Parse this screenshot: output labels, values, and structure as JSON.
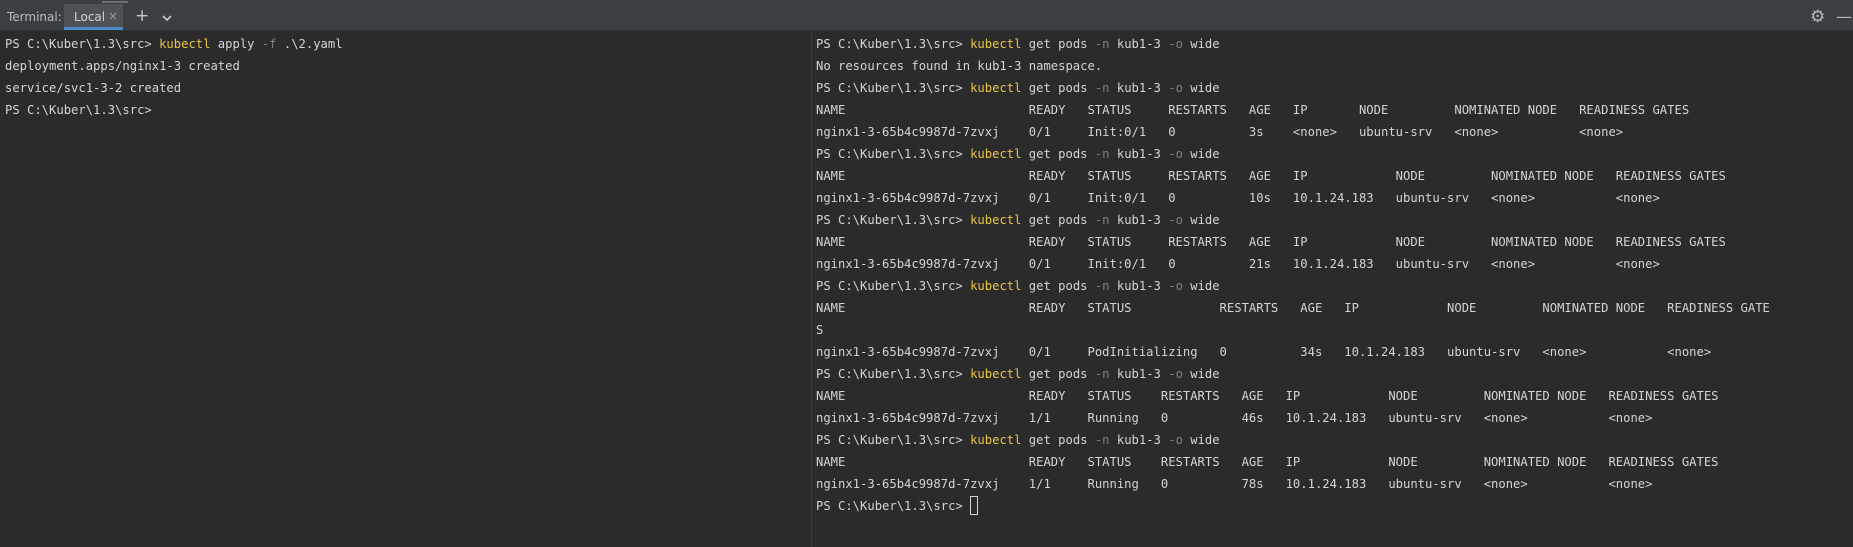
{
  "toolwindow": {
    "title": "Terminal:",
    "tab_label": "Local",
    "close_glyph": "×",
    "add_glyph": "+",
    "settings_glyph": "⚙",
    "hide_glyph": "—"
  },
  "left": {
    "lines": [
      [
        {
          "t": "PS C:\\Kuber\\1.3\\src> "
        },
        {
          "t": "kubectl",
          "c": "cmd"
        },
        {
          "t": " apply "
        },
        {
          "t": "-f",
          "c": "dim"
        },
        {
          "t": " .\\2.yaml"
        }
      ],
      [
        {
          "t": "deployment.apps/nginx1-3 created"
        }
      ],
      [
        {
          "t": "service/svc1-3-2 created"
        }
      ],
      [
        {
          "t": "PS C:\\Kuber\\1.3\\src>"
        }
      ]
    ]
  },
  "right": {
    "lines": [
      [
        {
          "t": "PS C:\\Kuber\\1.3\\src> "
        },
        {
          "t": "kubectl",
          "c": "cmd"
        },
        {
          "t": " get pods "
        },
        {
          "t": "-n",
          "c": "dim"
        },
        {
          "t": " kub1-3 "
        },
        {
          "t": "-o",
          "c": "dim"
        },
        {
          "t": " wide"
        }
      ],
      [
        {
          "t": "No resources found in kub1-3 namespace."
        }
      ],
      [
        {
          "t": "PS C:\\Kuber\\1.3\\src> "
        },
        {
          "t": "kubectl",
          "c": "cmd"
        },
        {
          "t": " get pods "
        },
        {
          "t": "-n",
          "c": "dim"
        },
        {
          "t": " kub1-3 "
        },
        {
          "t": "-o",
          "c": "dim"
        },
        {
          "t": " wide"
        }
      ],
      [
        {
          "t": "NAME                         READY   STATUS     RESTARTS   AGE   IP       NODE         NOMINATED NODE   READINESS GATES"
        }
      ],
      [
        {
          "t": "nginx1-3-65b4c9987d-7zvxj    0/1     Init:0/1   0          3s    <none>   ubuntu-srv   <none>           <none>"
        }
      ],
      [
        {
          "t": "PS C:\\Kuber\\1.3\\src> "
        },
        {
          "t": "kubectl",
          "c": "cmd"
        },
        {
          "t": " get pods "
        },
        {
          "t": "-n",
          "c": "dim"
        },
        {
          "t": " kub1-3 "
        },
        {
          "t": "-o",
          "c": "dim"
        },
        {
          "t": " wide"
        }
      ],
      [
        {
          "t": "NAME                         READY   STATUS     RESTARTS   AGE   IP            NODE         NOMINATED NODE   READINESS GATES"
        }
      ],
      [
        {
          "t": "nginx1-3-65b4c9987d-7zvxj    0/1     Init:0/1   0          10s   10.1.24.183   ubuntu-srv   <none>           <none>"
        }
      ],
      [
        {
          "t": "PS C:\\Kuber\\1.3\\src> "
        },
        {
          "t": "kubectl",
          "c": "cmd"
        },
        {
          "t": " get pods "
        },
        {
          "t": "-n",
          "c": "dim"
        },
        {
          "t": " kub1-3 "
        },
        {
          "t": "-o",
          "c": "dim"
        },
        {
          "t": " wide"
        }
      ],
      [
        {
          "t": "NAME                         READY   STATUS     RESTARTS   AGE   IP            NODE         NOMINATED NODE   READINESS GATES"
        }
      ],
      [
        {
          "t": "nginx1-3-65b4c9987d-7zvxj    0/1     Init:0/1   0          21s   10.1.24.183   ubuntu-srv   <none>           <none>"
        }
      ],
      [
        {
          "t": "PS C:\\Kuber\\1.3\\src> "
        },
        {
          "t": "kubectl",
          "c": "cmd"
        },
        {
          "t": " get pods "
        },
        {
          "t": "-n",
          "c": "dim"
        },
        {
          "t": " kub1-3 "
        },
        {
          "t": "-o",
          "c": "dim"
        },
        {
          "t": " wide"
        }
      ],
      [
        {
          "t": "NAME                         READY   STATUS            RESTARTS   AGE   IP            NODE         NOMINATED NODE   READINESS GATE"
        }
      ],
      [
        {
          "t": "S"
        }
      ],
      [
        {
          "t": "nginx1-3-65b4c9987d-7zvxj    0/1     PodInitializing   0          34s   10.1.24.183   ubuntu-srv   <none>           <none>"
        }
      ],
      [
        {
          "t": "PS C:\\Kuber\\1.3\\src> "
        },
        {
          "t": "kubectl",
          "c": "cmd"
        },
        {
          "t": " get pods "
        },
        {
          "t": "-n",
          "c": "dim"
        },
        {
          "t": " kub1-3 "
        },
        {
          "t": "-o",
          "c": "dim"
        },
        {
          "t": " wide"
        }
      ],
      [
        {
          "t": "NAME                         READY   STATUS    RESTARTS   AGE   IP            NODE         NOMINATED NODE   READINESS GATES"
        }
      ],
      [
        {
          "t": "nginx1-3-65b4c9987d-7zvxj    1/1     Running   0          46s   10.1.24.183   ubuntu-srv   <none>           <none>"
        }
      ],
      [
        {
          "t": "PS C:\\Kuber\\1.3\\src> "
        },
        {
          "t": "kubectl",
          "c": "cmd"
        },
        {
          "t": " get pods "
        },
        {
          "t": "-n",
          "c": "dim"
        },
        {
          "t": " kub1-3 "
        },
        {
          "t": "-o",
          "c": "dim"
        },
        {
          "t": " wide"
        }
      ],
      [
        {
          "t": "NAME                         READY   STATUS    RESTARTS   AGE   IP            NODE         NOMINATED NODE   READINESS GATES"
        }
      ],
      [
        {
          "t": "nginx1-3-65b4c9987d-7zvxj    1/1     Running   0          78s   10.1.24.183   ubuntu-srv   <none>           <none>"
        }
      ],
      [
        {
          "t": "PS C:\\Kuber\\1.3\\src> "
        },
        {
          "cursor": true
        }
      ]
    ]
  }
}
